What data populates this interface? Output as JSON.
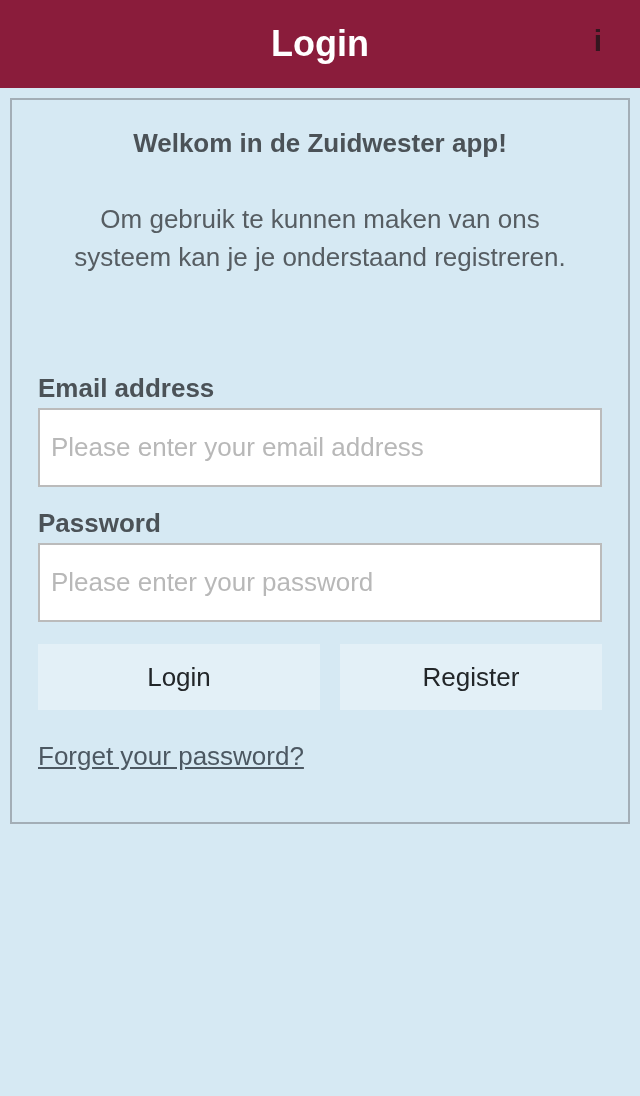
{
  "header": {
    "title": "Login",
    "info_button": "i"
  },
  "welcome": {
    "heading": "Welkom in de Zuidwester app!",
    "text": "Om gebruik te kunnen maken van ons systeem kan je je onderstaand registreren."
  },
  "form": {
    "fields": [
      {
        "label": "Email address",
        "placeholder": "Please enter your email address"
      },
      {
        "label": "Password",
        "placeholder": "Please enter your password"
      }
    ],
    "buttons": [
      {
        "label": "Login"
      },
      {
        "label": "Register"
      }
    ],
    "link": "Forget your password?"
  }
}
